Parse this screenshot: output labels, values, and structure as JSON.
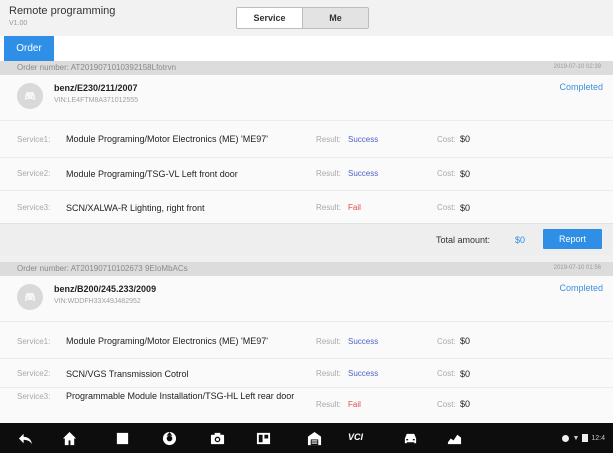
{
  "header": {
    "title": "Remote programming",
    "version": "V1.00",
    "segments": [
      "Service",
      "Me"
    ]
  },
  "tabs": {
    "order_label": "Order"
  },
  "orders": [
    {
      "order_number": "Order number: AT2019071010392158Lfotrvn",
      "date": "2019-07-10 02:39",
      "car_model": "benz/E230/211/2007",
      "vin": "VIN:LE4FTM8A371012555",
      "status": "Completed",
      "services": [
        {
          "label": "Service1:",
          "name": "Module Programing/Motor Electronics (ME) 'ME97'",
          "result_label": "Result:",
          "result": "Success",
          "cost_label": "Cost:",
          "cost": "$0"
        },
        {
          "label": "Service2:",
          "name": "Module Programing/TSG-VL Left front door",
          "result_label": "Result:",
          "result": "Success",
          "cost_label": "Cost:",
          "cost": "$0"
        },
        {
          "label": "Service3:",
          "name": "SCN/XALWA-R Lighting, right front",
          "result_label": "Result:",
          "result": "Fail",
          "cost_label": "Cost:",
          "cost": "$0"
        }
      ],
      "total_label": "Total amount:",
      "total": "$0",
      "report_label": "Report"
    },
    {
      "order_number": "Order number: AT20190710102673 9EIoMbACs",
      "date": "2019-07-10 01:56",
      "car_model": "benz/B200/245.233/2009",
      "vin": "VIN:WDDFH33X49J482952",
      "status": "Completed",
      "services": [
        {
          "label": "Service1:",
          "name": "Module Programing/Motor Electronics (ME) 'ME97'",
          "result_label": "Result:",
          "result": "Success",
          "cost_label": "Cost:",
          "cost": "$0"
        },
        {
          "label": "Service2:",
          "name": "SCN/VGS Transmission Cotrol",
          "result_label": "Result:",
          "result": "Success",
          "cost_label": "Cost:",
          "cost": "$0"
        },
        {
          "label": "Service3:",
          "name": "Programmable Module Installation/TSG-HL Left rear door",
          "result_label": "Result:",
          "result": "Fail",
          "cost_label": "Cost:",
          "cost": "$0"
        }
      ]
    }
  ],
  "navbar": {
    "icons": [
      "back-icon",
      "home-icon",
      "recent-apps-icon",
      "browser-icon",
      "camera-icon",
      "screen-mirror-icon",
      "garage-icon",
      "vci-icon",
      "car-icon",
      "diagnostics-icon"
    ],
    "vci_label": "VCI",
    "status_time": "12:4"
  },
  "colors": {
    "accent": "#2f8fe6",
    "success": "#5060c8",
    "fail": "#e84b4b"
  }
}
